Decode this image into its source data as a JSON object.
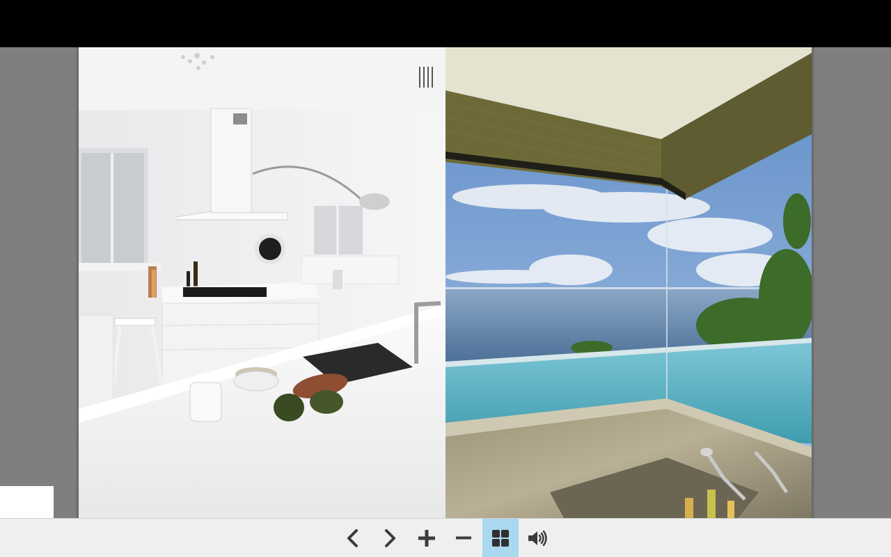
{
  "viewer": {
    "mode": "two-page spread",
    "left_page": {
      "image": "white-kitchen-interior"
    },
    "right_page": {
      "image": "ocean-view-bathroom-infinity-pool"
    }
  },
  "toolbar": {
    "buttons": [
      {
        "name": "previous-page",
        "icon": "chevron-left-icon"
      },
      {
        "name": "next-page",
        "icon": "chevron-right-icon"
      },
      {
        "name": "zoom-in",
        "icon": "plus-icon"
      },
      {
        "name": "zoom-out",
        "icon": "minus-icon"
      },
      {
        "name": "thumbnails-grid",
        "icon": "grid-icon",
        "active": true
      },
      {
        "name": "sound",
        "icon": "speaker-icon"
      }
    ],
    "icon_color": "#3c3c3c",
    "active_color": "#a9d8ef"
  }
}
